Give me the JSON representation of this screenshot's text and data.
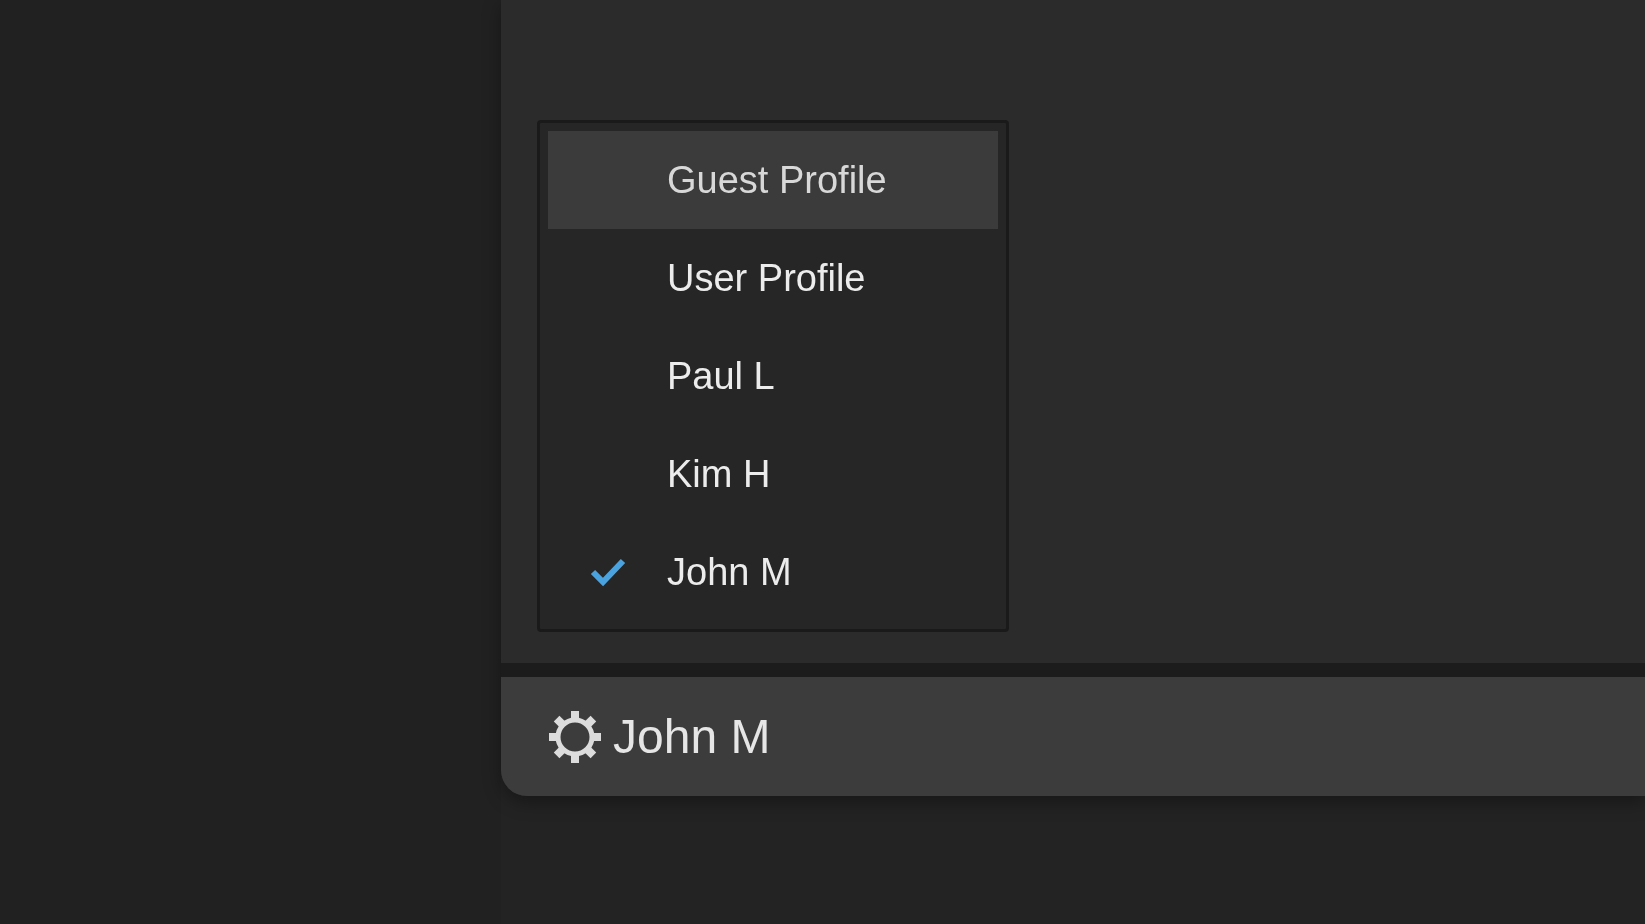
{
  "profile_menu": {
    "items": [
      {
        "label": "Guest Profile",
        "highlighted": true,
        "selected": false
      },
      {
        "label": "User Profile",
        "highlighted": false,
        "selected": false
      },
      {
        "label": "Paul L",
        "highlighted": false,
        "selected": false
      },
      {
        "label": "Kim H",
        "highlighted": false,
        "selected": false
      },
      {
        "label": "John M",
        "highlighted": false,
        "selected": true
      }
    ]
  },
  "status_bar": {
    "profile": "John M"
  }
}
